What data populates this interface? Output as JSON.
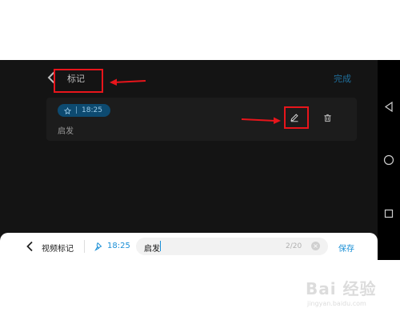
{
  "header": {
    "title": "标记",
    "done_label": "完成"
  },
  "note": {
    "time": "18:25",
    "separator": "|",
    "text": "启发"
  },
  "bottom_bar": {
    "title": "视频标记",
    "time": "18:25",
    "input_value": "启发",
    "counter": "2/20",
    "clear_symbol": "×",
    "save_label": "保存"
  },
  "watermark": {
    "logo_text": "Bai 经验",
    "site": "jingyan.baidu.com"
  },
  "colors": {
    "screen_bg": "#141414",
    "card_bg": "#1c1c1c",
    "accent_blue": "#1a8fd6",
    "badge_bg": "#0d4a70",
    "annotation_red": "#e8151b"
  },
  "icons": {
    "back": "chevron-left-icon",
    "pin": "pin-icon",
    "edit": "pencil-icon",
    "delete": "trash-icon",
    "nav_back": "triangle-back-icon",
    "nav_home": "circle-home-icon",
    "nav_recents": "square-recents-icon"
  }
}
